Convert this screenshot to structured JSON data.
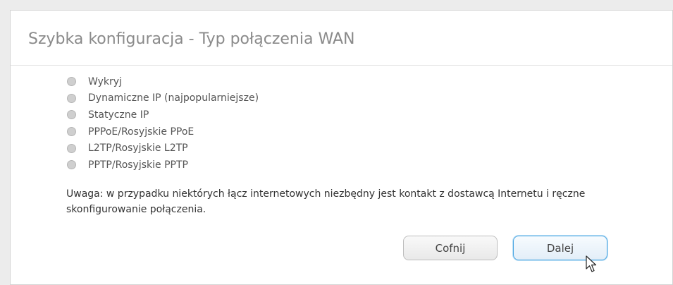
{
  "page": {
    "title": "Szybka konfiguracja - Typ połączenia WAN"
  },
  "options": [
    {
      "label": "Wykryj",
      "selected": false
    },
    {
      "label": "Dynamiczne IP (najpopularniejsze)",
      "selected": false
    },
    {
      "label": "Statyczne IP",
      "selected": false
    },
    {
      "label": "PPPoE/Rosyjskie PPoE",
      "selected": false
    },
    {
      "label": "L2TP/Rosyjskie L2TP",
      "selected": false
    },
    {
      "label": "PPTP/Rosyjskie PPTP",
      "selected": false
    }
  ],
  "note": "Uwaga: w przypadku niektórych łącz internetowych niezbędny jest kontakt z dostawcą Internetu i ręczne skonfigurowanie połączenia.",
  "buttons": {
    "back_label": "Cofnij",
    "next_label": "Dalej"
  },
  "colors": {
    "title_text": "#8a8a8a",
    "radio_fill": "#cfcfcf",
    "next_border": "#4aa6e2"
  },
  "cursor": {
    "icon": "arrow-pointer-icon"
  }
}
